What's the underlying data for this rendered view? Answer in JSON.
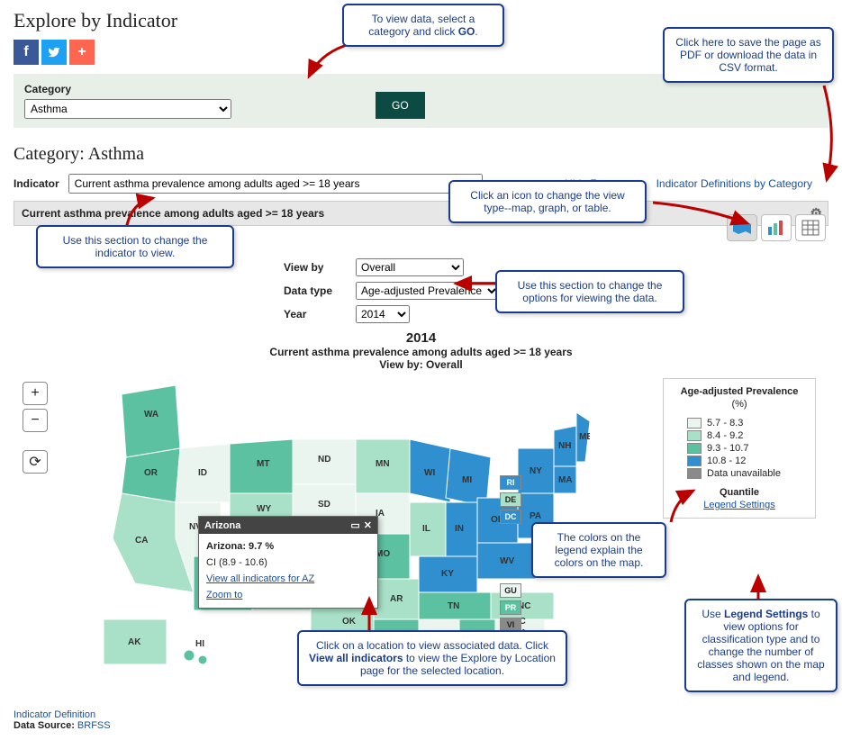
{
  "header": {
    "title": "Explore by Indicator",
    "social": {
      "fb": "f",
      "tw": "t",
      "plus": "+"
    }
  },
  "category_bar": {
    "label": "Category",
    "selected": "Asthma",
    "go": "GO"
  },
  "category_title": "Category: Asthma",
  "indicator": {
    "label": "Indicator",
    "selected": "Current asthma prevalence among adults aged >= 18 years"
  },
  "right_links": {
    "hide_footnotes": "Hide Footnotes",
    "ind_defs": "Indicator Definitions by Category"
  },
  "subheader": "Current asthma prevalence among adults aged >= 18 years",
  "view_icons": {
    "map": "map-icon",
    "bar": "bar-chart-icon",
    "table": "table-icon"
  },
  "controls": {
    "viewby_label": "View by",
    "viewby_value": "Overall",
    "datatype_label": "Data type",
    "datatype_value": "Age-adjusted Prevalence",
    "year_label": "Year",
    "year_value": "2014"
  },
  "chart_head": {
    "year": "2014",
    "sub": "Current asthma prevalence among adults aged >= 18 years",
    "viewby": "View by: Overall"
  },
  "legend": {
    "title": "Age-adjusted Prevalence",
    "unit": "(%)",
    "rows": [
      {
        "color": "#e9f5ee",
        "label": "5.7 - 8.3"
      },
      {
        "color": "#a9e0c8",
        "label": "8.4 - 9.2"
      },
      {
        "color": "#5cc1a1",
        "label": "9.3 - 10.7"
      },
      {
        "color": "#2f8fcf",
        "label": "10.8 - 12"
      },
      {
        "color": "#8a8a8a",
        "label": "Data unavailable"
      }
    ],
    "quantile": "Quantile",
    "settings": "Legend Settings"
  },
  "popup": {
    "title": "Arizona",
    "value": "Arizona: 9.7 %",
    "ci": "CI (8.9 - 10.6)",
    "viewall": "View all indicators for AZ",
    "zoom": "Zoom to"
  },
  "territories1": [
    {
      "abbr": "RI",
      "color": "#2f8fcf"
    },
    {
      "abbr": "DE",
      "color": "#a9e0c8"
    },
    {
      "abbr": "DC",
      "color": "#2f8fcf"
    }
  ],
  "territories2": [
    {
      "abbr": "GU",
      "color": "#e9f5ee"
    },
    {
      "abbr": "PR",
      "color": "#5cc1a1"
    },
    {
      "abbr": "VI",
      "color": "#8a8a8a"
    }
  ],
  "footer": {
    "ind_def": "Indicator Definition",
    "ds_label": "Data Source:",
    "ds_value": "BRFSS"
  },
  "callouts": {
    "c1": "To view data, select a category and click ",
    "c1b": "GO",
    "c1c": ".",
    "c2": "Click here to save the page as PDF or download the data in CSV format.",
    "c3": "Use this section to change the indicator to view.",
    "c4": "Click an icon to change the view type--map, graph, or table.",
    "c5": "Use this section to change the options for viewing the data.",
    "c6": "The colors on the legend explain the colors on the map.",
    "c7a": "Use ",
    "c7b": "Legend Settings",
    "c7c": " to view options for classification type and to change the number of classes shown on the map and legend.",
    "c8a": "Click on a location to view associated data. Click ",
    "c8b": "View all indicators",
    "c8c": " to view the Explore by Location page for the selected location."
  }
}
